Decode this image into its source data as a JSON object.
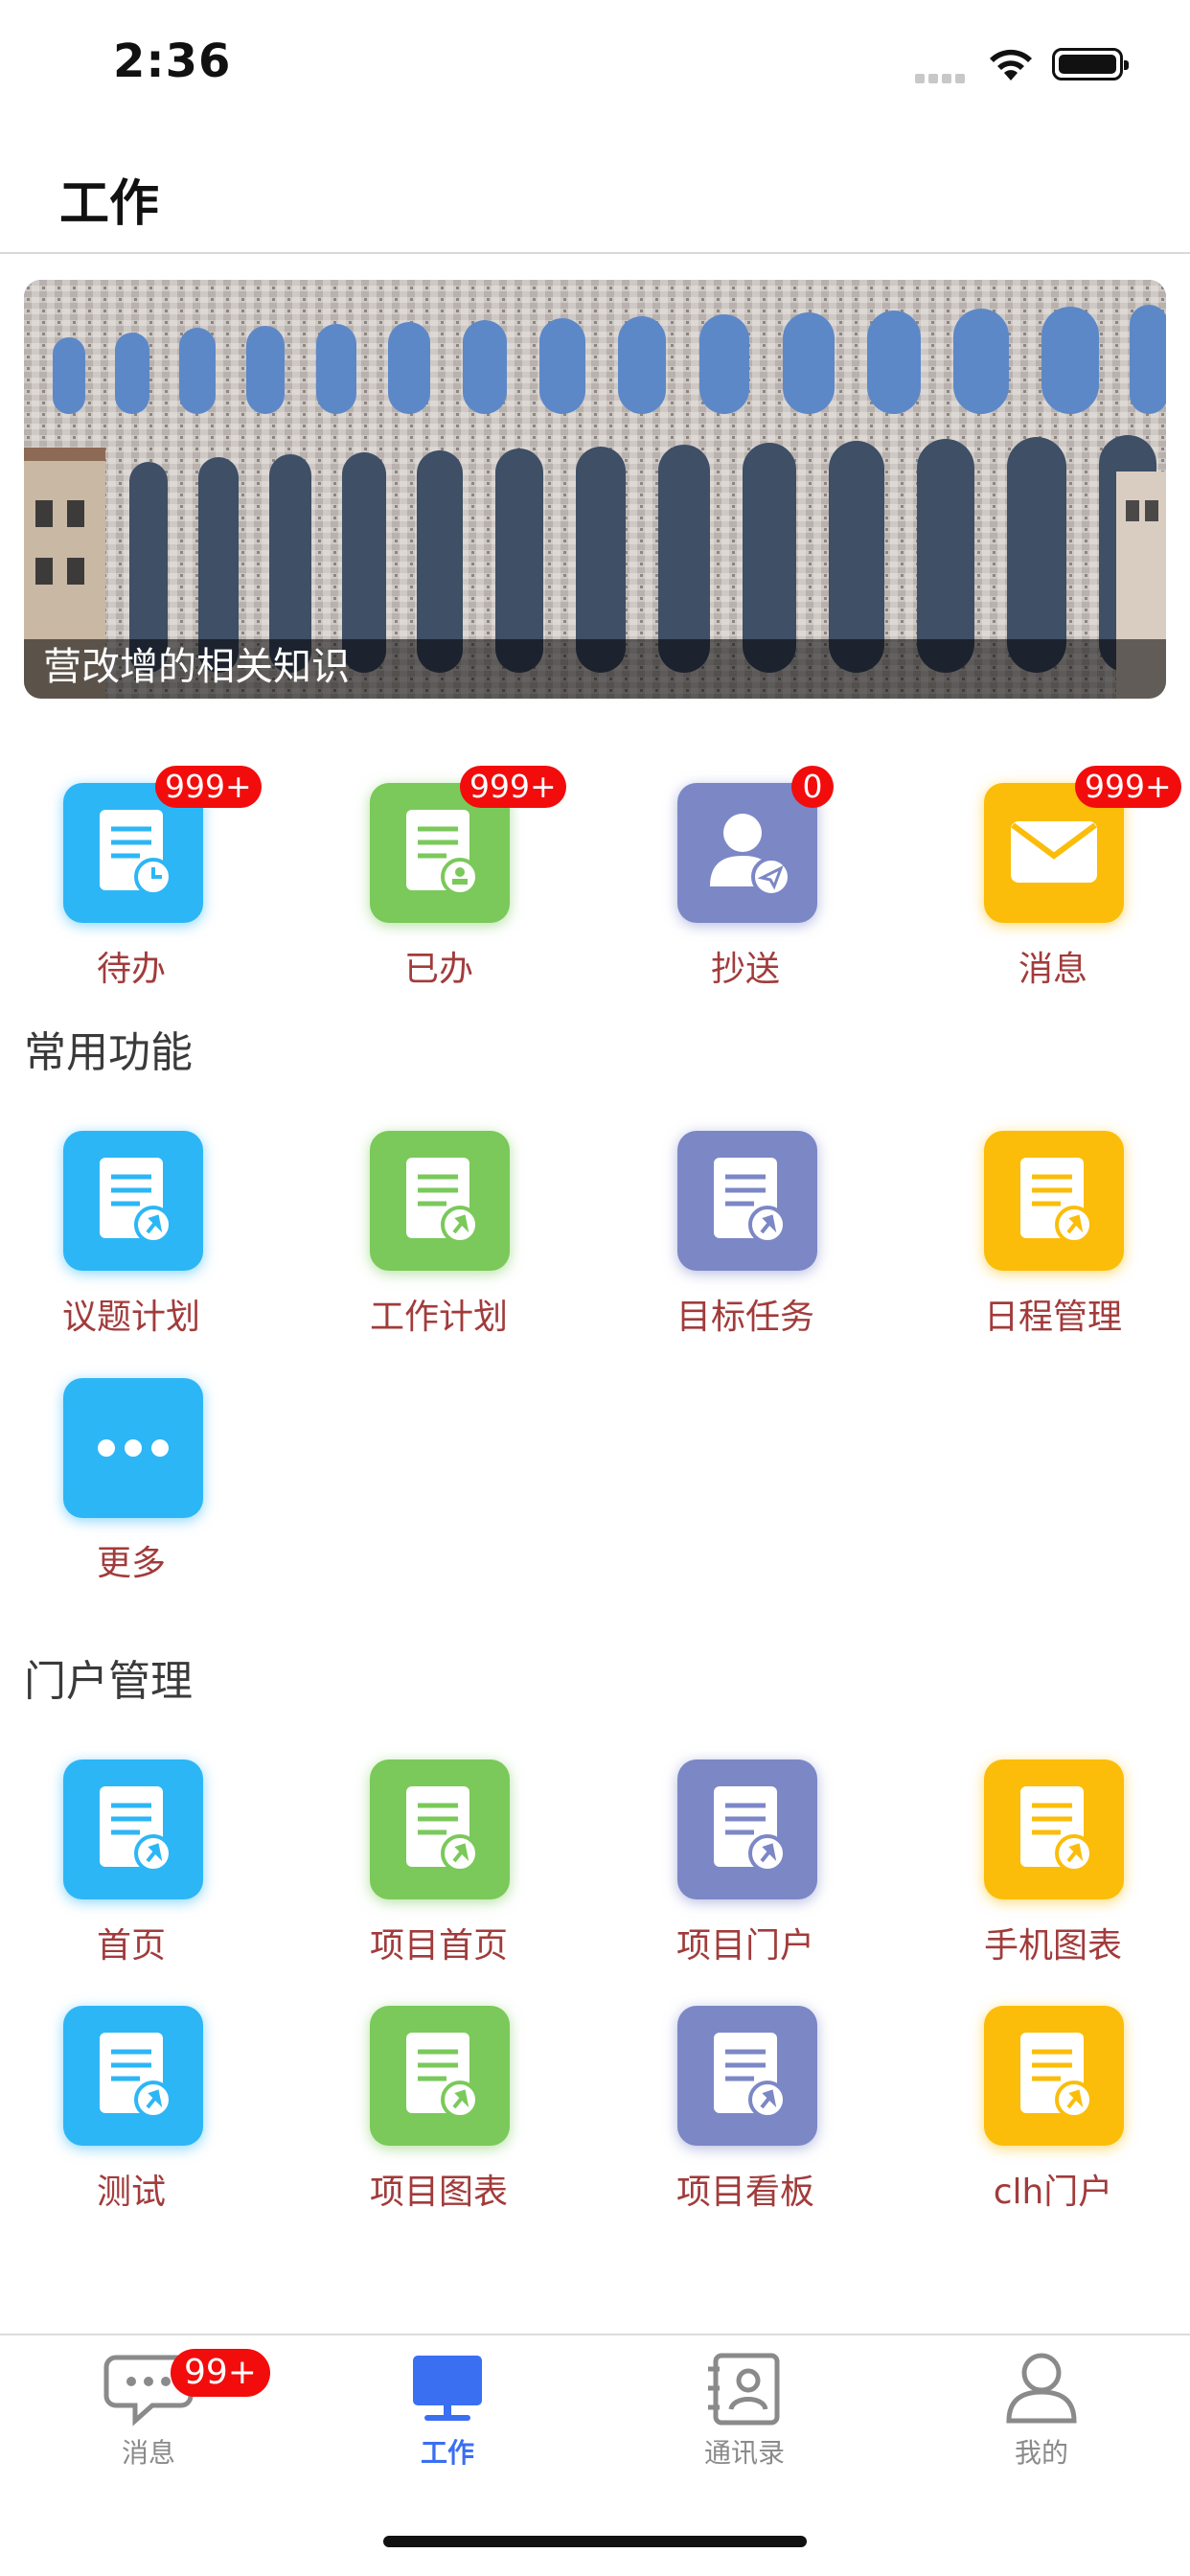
{
  "status_bar": {
    "time": "2:36"
  },
  "header": {
    "title": "工作"
  },
  "banner": {
    "caption": "营改增的相关知识"
  },
  "summary": [
    {
      "label": "待办",
      "badge": "999+",
      "color": "#2cb6f6",
      "icon": "todo-clock-icon"
    },
    {
      "label": "已办",
      "badge": "999+",
      "color": "#7ac95a",
      "icon": "done-stamp-icon"
    },
    {
      "label": "抄送",
      "badge": "0",
      "color": "#7c87c6",
      "icon": "cc-user-icon"
    },
    {
      "label": "消息",
      "badge": "999+",
      "color": "#fbbd09",
      "icon": "mail-icon"
    }
  ],
  "common": {
    "title": "常用功能",
    "items": [
      {
        "label": "议题计划",
        "color": "#2cb6f6",
        "icon": "pinned-doc-icon"
      },
      {
        "label": "工作计划",
        "color": "#7ac95a",
        "icon": "pinned-doc-icon"
      },
      {
        "label": "目标任务",
        "color": "#7c87c6",
        "icon": "pinned-doc-icon"
      },
      {
        "label": "日程管理",
        "color": "#fbbd09",
        "icon": "pinned-doc-icon"
      },
      {
        "label": "更多",
        "color": "#2cb6f6",
        "icon": "more-dots-icon"
      }
    ]
  },
  "portal": {
    "title": "门户管理",
    "items": [
      {
        "label": "首页",
        "color": "#2cb6f6",
        "icon": "pinned-doc-icon"
      },
      {
        "label": "项目首页",
        "color": "#7ac95a",
        "icon": "pinned-doc-icon"
      },
      {
        "label": "项目门户",
        "color": "#7c87c6",
        "icon": "pinned-doc-icon"
      },
      {
        "label": "手机图表",
        "color": "#fbbd09",
        "icon": "pinned-doc-icon"
      },
      {
        "label": "测试",
        "color": "#2cb6f6",
        "icon": "pinned-doc-icon"
      },
      {
        "label": "项目图表",
        "color": "#7ac95a",
        "icon": "pinned-doc-icon"
      },
      {
        "label": "项目看板",
        "color": "#7c87c6",
        "icon": "pinned-doc-icon"
      },
      {
        "label": "clh门户",
        "color": "#fbbd09",
        "icon": "pinned-doc-icon"
      }
    ]
  },
  "tabbar": {
    "active": "工作",
    "active_color": "#3a6ff2",
    "items": [
      {
        "label": "消息",
        "badge": "99+",
        "icon": "chat-bubble-icon"
      },
      {
        "label": "工作",
        "icon": "monitor-icon"
      },
      {
        "label": "通讯录",
        "icon": "contacts-icon"
      },
      {
        "label": "我的",
        "icon": "person-icon"
      }
    ]
  }
}
